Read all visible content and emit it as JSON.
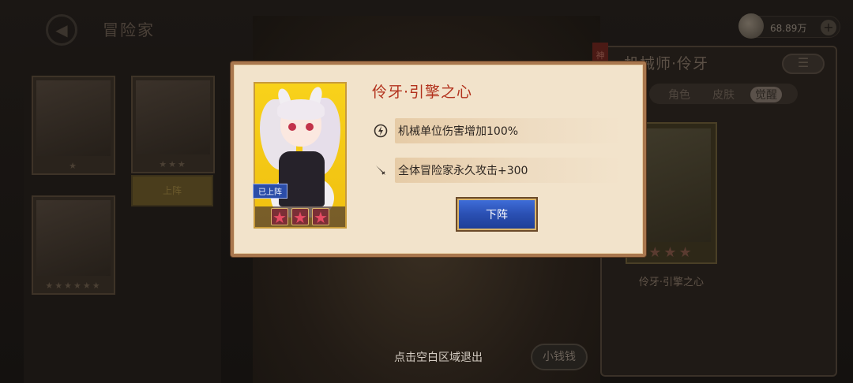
{
  "header": {
    "title": "冒险家",
    "currency_value": "68.89万"
  },
  "left_panel": {
    "cards": [
      {
        "stars": "★"
      },
      {
        "stars": "★★★"
      },
      {
        "stars": "★★★★★★"
      }
    ],
    "on_button_label": "上阵"
  },
  "right_panel": {
    "title": "机械师·伶牙",
    "side_tag": "神",
    "tabs": [
      "角色",
      "皮肤",
      "觉醒"
    ],
    "active_tab": "觉醒",
    "card_name": "伶牙·引擎之心",
    "card_stars": "★★★"
  },
  "modal": {
    "title": "伶牙·引擎之心",
    "deploy_tag": "已上阵",
    "star_count": 3,
    "effects": [
      {
        "icon": "lightning-icon",
        "text": "机械单位伤害增加100%"
      },
      {
        "icon": "sword-icon",
        "text": "全体冒险家永久攻击+300"
      }
    ],
    "button_label": "下阵"
  },
  "footer": {
    "exit_hint": "点击空白区域退出",
    "money_button": "小钱钱"
  },
  "colors": {
    "modal_bg": "#f2e3cb",
    "modal_border": "#a9774e",
    "title_red": "#b2311c",
    "button_blue": "#2a4fb2",
    "portrait_yellow": "#f3c618"
  }
}
